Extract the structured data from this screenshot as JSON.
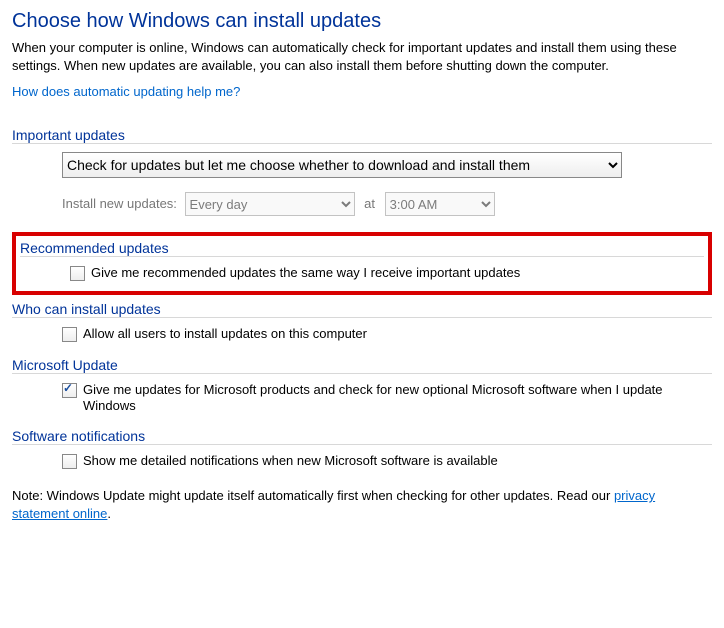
{
  "title": "Choose how Windows can install updates",
  "description": "When your computer is online, Windows can automatically check for important updates and install them using these settings. When new updates are available, you can also install them before shutting down the computer.",
  "help_link": "How does automatic updating help me?",
  "sections": {
    "important": {
      "header": "Important updates",
      "dropdown_value": "Check for updates but let me choose whether to download and install them",
      "schedule_label": "Install new updates:",
      "every_value": "Every day",
      "at_label": "at",
      "time_value": "3:00 AM"
    },
    "recommended": {
      "header": "Recommended updates",
      "checkbox_label": "Give me recommended updates the same way I receive important updates"
    },
    "who": {
      "header": "Who can install updates",
      "checkbox_label": "Allow all users to install updates on this computer"
    },
    "msupdate": {
      "header": "Microsoft Update",
      "checkbox_label": "Give me updates for Microsoft products and check for new optional Microsoft software when I update Windows"
    },
    "notifications": {
      "header": "Software notifications",
      "checkbox_label": "Show me detailed notifications when new Microsoft software is available"
    }
  },
  "note_prefix": "Note: Windows Update might update itself automatically first when checking for other updates.  Read our ",
  "note_link": "privacy statement online",
  "note_suffix": "."
}
